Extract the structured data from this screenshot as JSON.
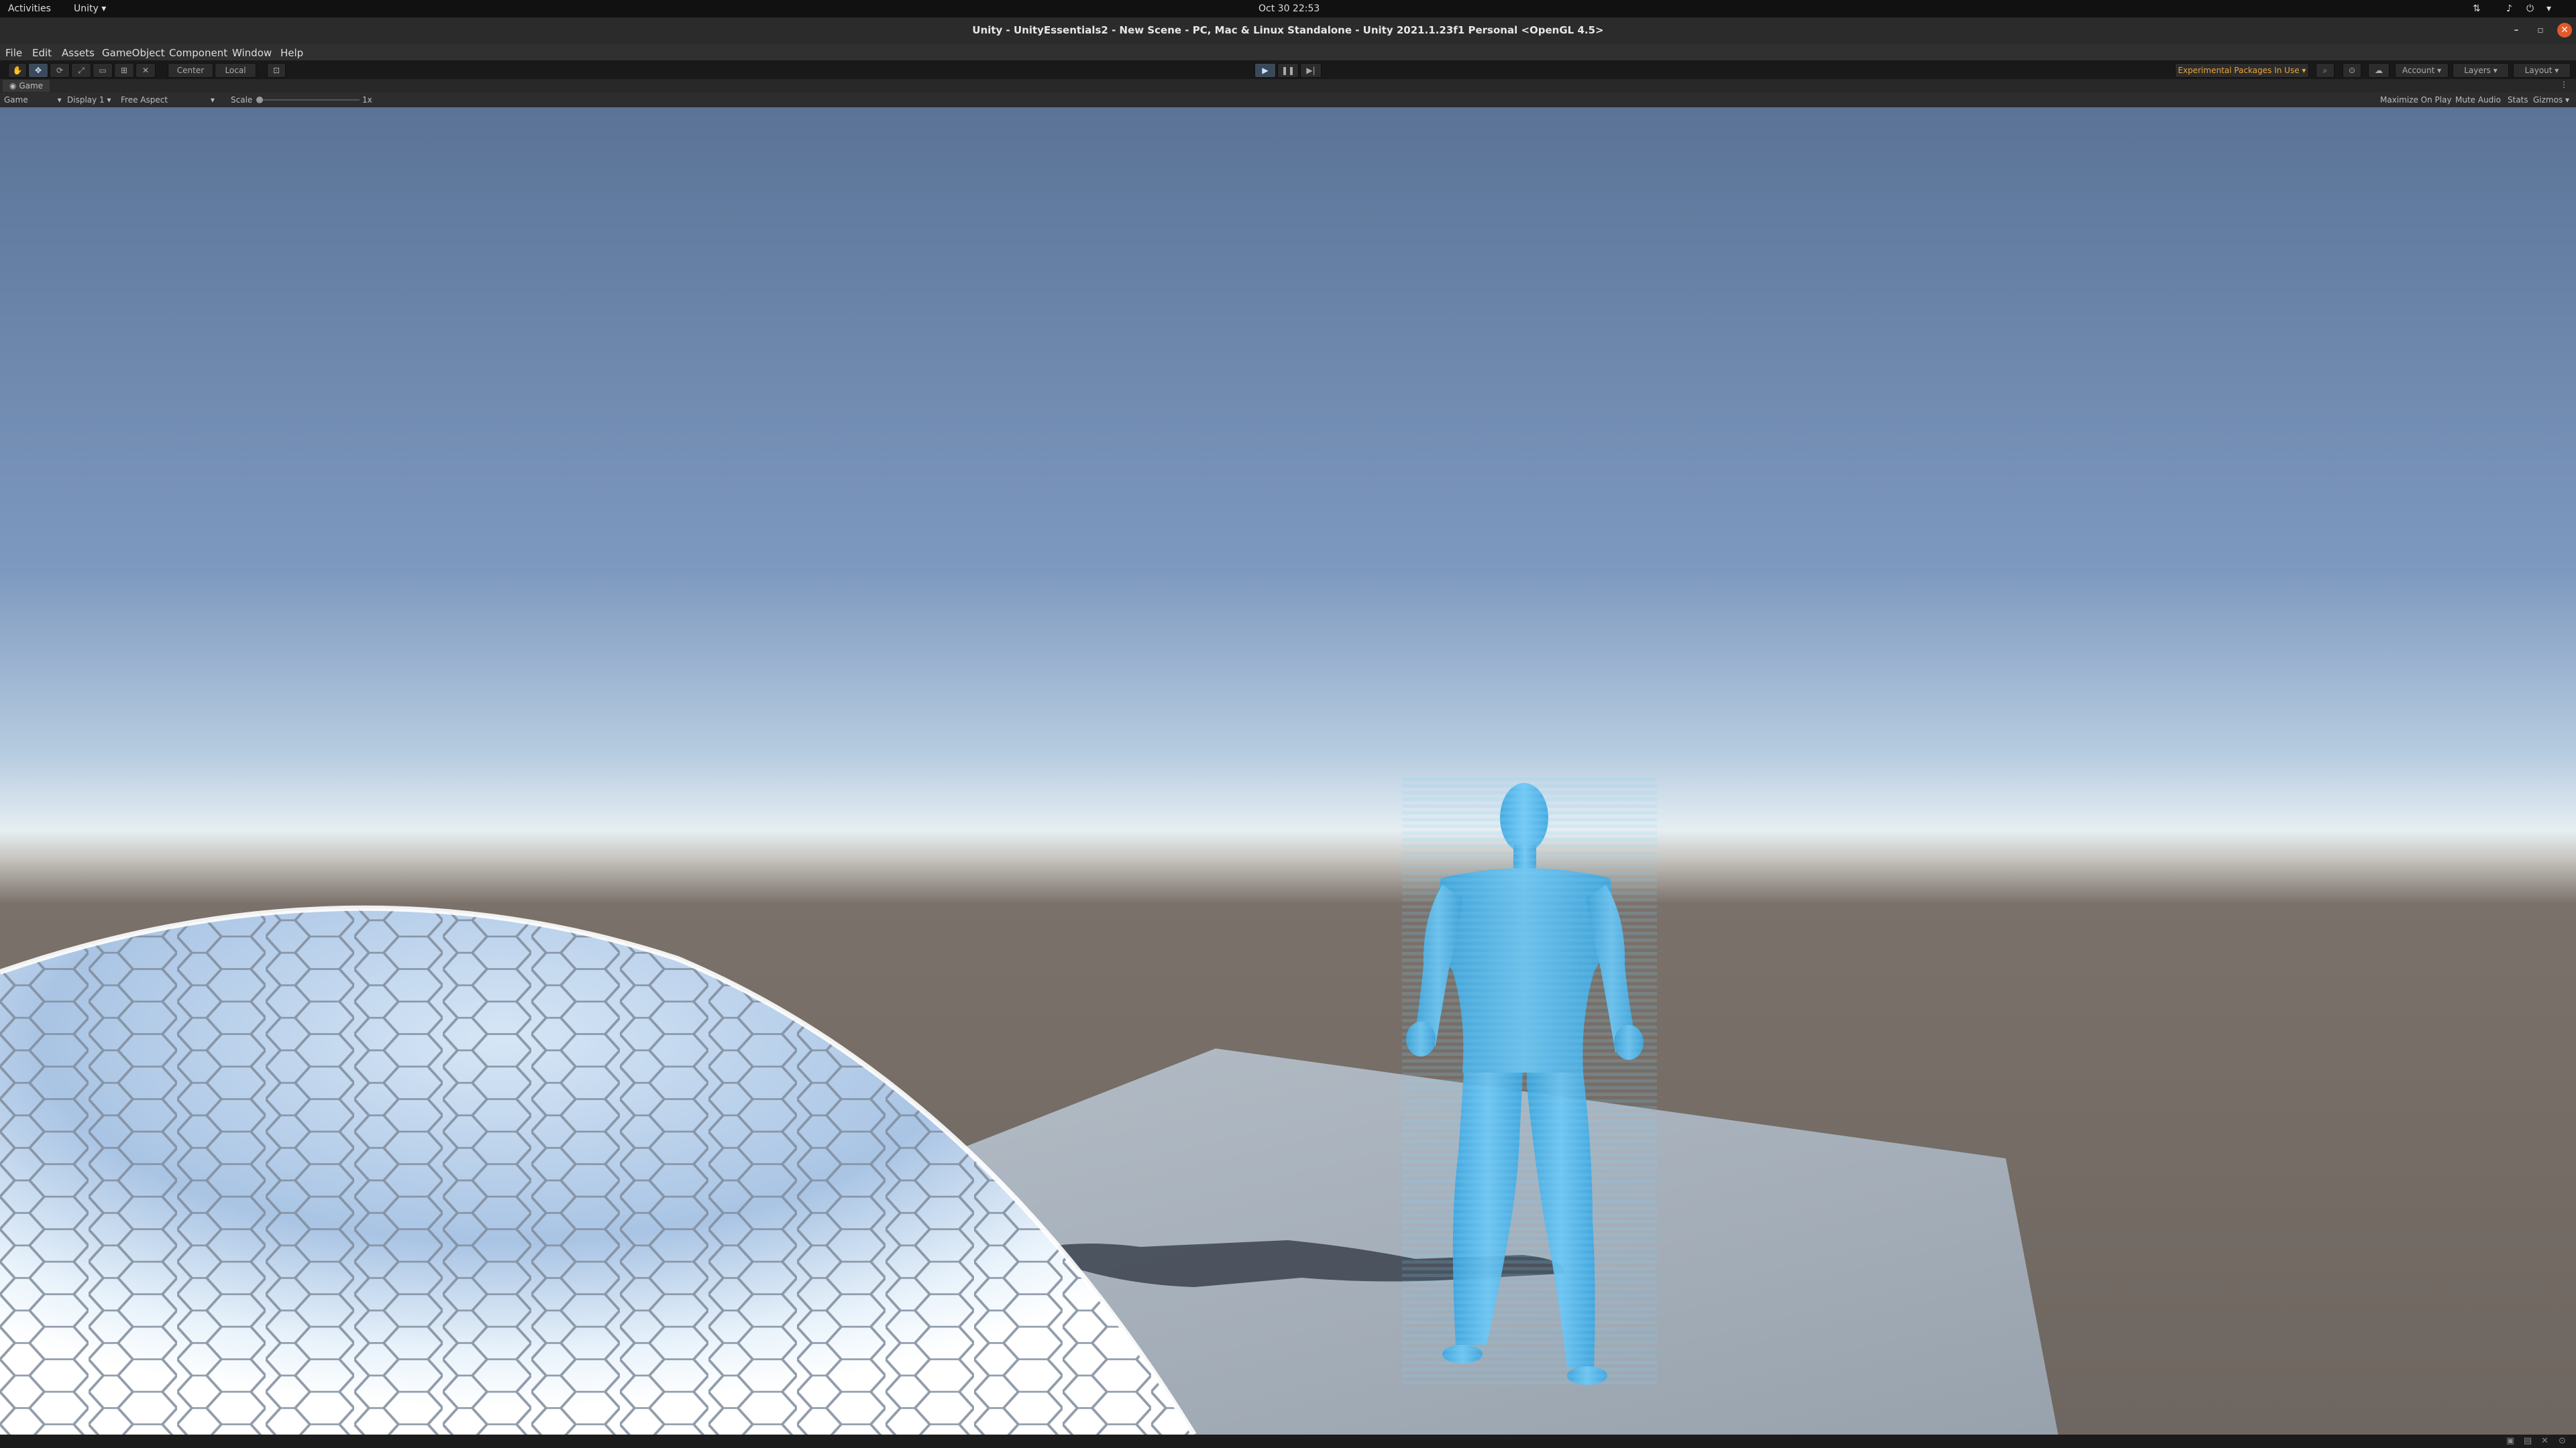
{
  "system_bar": {
    "activities": "Activities",
    "app_menu": "Unity ▾",
    "clock": "Oct 30  22:53"
  },
  "window": {
    "title": "Unity - UnityEssentials2 - New Scene - PC, Mac & Linux Standalone - Unity 2021.1.23f1 Personal <OpenGL 4.5>"
  },
  "menu": [
    "File",
    "Edit",
    "Assets",
    "GameObject",
    "Component",
    "Window",
    "Help"
  ],
  "toolbar": {
    "pivot_mode": "Center",
    "pivot_rotation": "Local",
    "experimental_badge": "Experimental Packages In Use ▾",
    "account": "Account",
    "layers": "Layers",
    "layout": "Layout",
    "play_icon": "play-icon",
    "pause_icon": "pause-icon",
    "step_icon": "step-icon"
  },
  "game_tab": {
    "label": "Game"
  },
  "game_options": {
    "view_select": "Game",
    "display": "Display 1",
    "aspect": "Free Aspect",
    "scale_label": "Scale",
    "scale_value": "1x",
    "maximize_on_play": "Maximize On Play",
    "mute_audio": "Mute Audio",
    "stats": "Stats",
    "gizmos": "Gizmos"
  },
  "colors": {
    "sky_top": "#5a7397",
    "horizon": "#e6eef2",
    "ground": "#6e6660",
    "cube": "#a8b1ba",
    "hologram": "#4fb8f0",
    "experimental": "#e8a33a"
  }
}
